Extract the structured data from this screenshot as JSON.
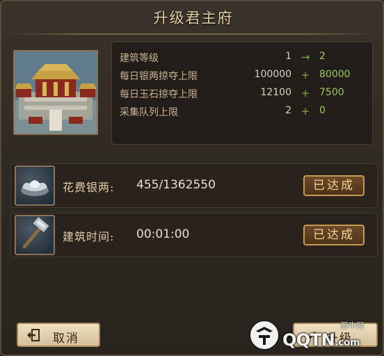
{
  "dialog": {
    "title": "升级君主府"
  },
  "stats": [
    {
      "label": "建筑等级",
      "current": "1",
      "op": "→",
      "next": "2"
    },
    {
      "label": "每日银两掠夺上限",
      "current": "100000",
      "op": "+",
      "next": "80000"
    },
    {
      "label": "每日玉石掠夺上限",
      "current": "12100",
      "op": "+",
      "next": "7500"
    },
    {
      "label": "采集队列上限",
      "current": "2",
      "op": "+",
      "next": "0"
    }
  ],
  "requirements": [
    {
      "label": "花费银两:",
      "value": "455/1362550",
      "status": "已达成",
      "icon": "silver-ingot-icon"
    },
    {
      "label": "建筑时间:",
      "value": "00:01:00",
      "status": "已达成",
      "icon": "hammer-icon"
    }
  ],
  "buttons": {
    "cancel": "取消",
    "confirm": "升级"
  },
  "watermark": {
    "site": "QQTN",
    "domain_suffix": ".com",
    "small": "腾牛网"
  },
  "colors": {
    "accent_green": "#9ccb5a",
    "title_gold": "#e3cba2",
    "badge_border": "#c99a52"
  }
}
